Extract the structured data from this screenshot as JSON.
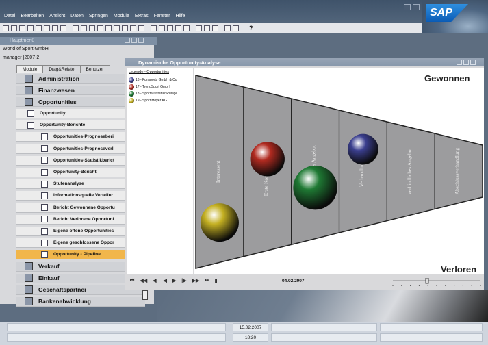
{
  "menubar": [
    "Datei",
    "Bearbeiten",
    "Ansicht",
    "Daten",
    "Springen",
    "Module",
    "Extras",
    "Fenster",
    "Hilfe"
  ],
  "brand": "SAP",
  "main_menu": {
    "title": "Hauptmenü",
    "company": "World of Sport GmbH",
    "user": "manager  [2007-2]",
    "tabs": [
      "Module",
      "Drag&Relate",
      "Benutzer"
    ],
    "items": [
      {
        "label": "Administration",
        "level": "cat",
        "icon": "admin-icon"
      },
      {
        "label": "Finanzwesen",
        "level": "cat",
        "icon": "finance-icon"
      },
      {
        "label": "Opportunities",
        "level": "cat",
        "icon": "opportunities-icon"
      },
      {
        "label": "Opportunity",
        "level": "sub",
        "icon": "document-icon"
      },
      {
        "label": "Opportunity-Berichte",
        "level": "sub",
        "icon": "folder-icon"
      },
      {
        "label": "Opportunities-Prognoseberi",
        "level": "sub2",
        "icon": "report-icon"
      },
      {
        "label": "Opportunities-Prognoseverl",
        "level": "sub2",
        "icon": "report-icon"
      },
      {
        "label": "Opportunities-Statistikberict",
        "level": "sub2",
        "icon": "report-icon"
      },
      {
        "label": "Opportunity-Bericht",
        "level": "sub2",
        "icon": "report-icon"
      },
      {
        "label": "Stufenanalyse",
        "level": "sub2",
        "icon": "report-icon"
      },
      {
        "label": "Informationsquelle Verteilur",
        "level": "sub2",
        "icon": "report-icon"
      },
      {
        "label": "Bericht Gewonnene Opportu",
        "level": "sub2",
        "icon": "report-icon"
      },
      {
        "label": "Bericht Verlorene Opportuni",
        "level": "sub2",
        "icon": "report-icon"
      },
      {
        "label": "Eigene offene Opportunities",
        "level": "sub2",
        "icon": "report-icon"
      },
      {
        "label": "Eigene geschlossene Oppor",
        "level": "sub2",
        "icon": "report-icon"
      },
      {
        "label": "Opportunity - Pipeline",
        "level": "sub2",
        "icon": "report-icon",
        "highlight": true
      },
      {
        "label": "Verkauf",
        "level": "cat",
        "icon": "sales-icon"
      },
      {
        "label": "Einkauf",
        "level": "cat",
        "icon": "purchase-icon"
      },
      {
        "label": "Geschäftspartner",
        "level": "cat",
        "icon": "partner-icon"
      },
      {
        "label": "Bankenabwicklung",
        "level": "cat",
        "icon": "bank-icon"
      }
    ]
  },
  "dialog": {
    "title": "Dynamische Opportunity-Analyse",
    "legend_title": "Legende - Opportunities",
    "legend": [
      {
        "label": "16 - Funsports GmbH & Co",
        "color": "#3b3f8f"
      },
      {
        "label": "17 - TrendSport GmbH",
        "color": "#b02a20"
      },
      {
        "label": "18 - Sportausstatter Rüdige",
        "color": "#1f7a34"
      },
      {
        "label": "19 - Sport Meyer KG",
        "color": "#c4b022"
      }
    ],
    "won_label": "Gewonnen",
    "lost_label": "Verloren",
    "stages": [
      "Interessent",
      "Erste Kontaktaufnahme",
      "Unverbindliches Angebot",
      "Verhandlungen",
      "verbindliches Angebot",
      "Abschlussverhandlung"
    ],
    "bubbles": [
      {
        "stage": 0,
        "pos": 0.78,
        "size": 1.0,
        "color": "#c4b022"
      },
      {
        "stage": 1,
        "pos": 0.42,
        "size": 0.9,
        "color": "#b02a20"
      },
      {
        "stage": 2,
        "pos": 0.62,
        "size": 1.15,
        "color": "#1f7a34"
      },
      {
        "stage": 3,
        "pos": 0.3,
        "size": 0.8,
        "color": "#3b3f8f"
      }
    ],
    "player_controls": [
      "⏮",
      "◀◀",
      "◀|",
      "◀",
      "▶",
      "|▶",
      "▶▶",
      "⏭",
      "▮"
    ],
    "date": "04.02.2007"
  },
  "status": {
    "date": "15.02.2007",
    "time": "18:20"
  }
}
